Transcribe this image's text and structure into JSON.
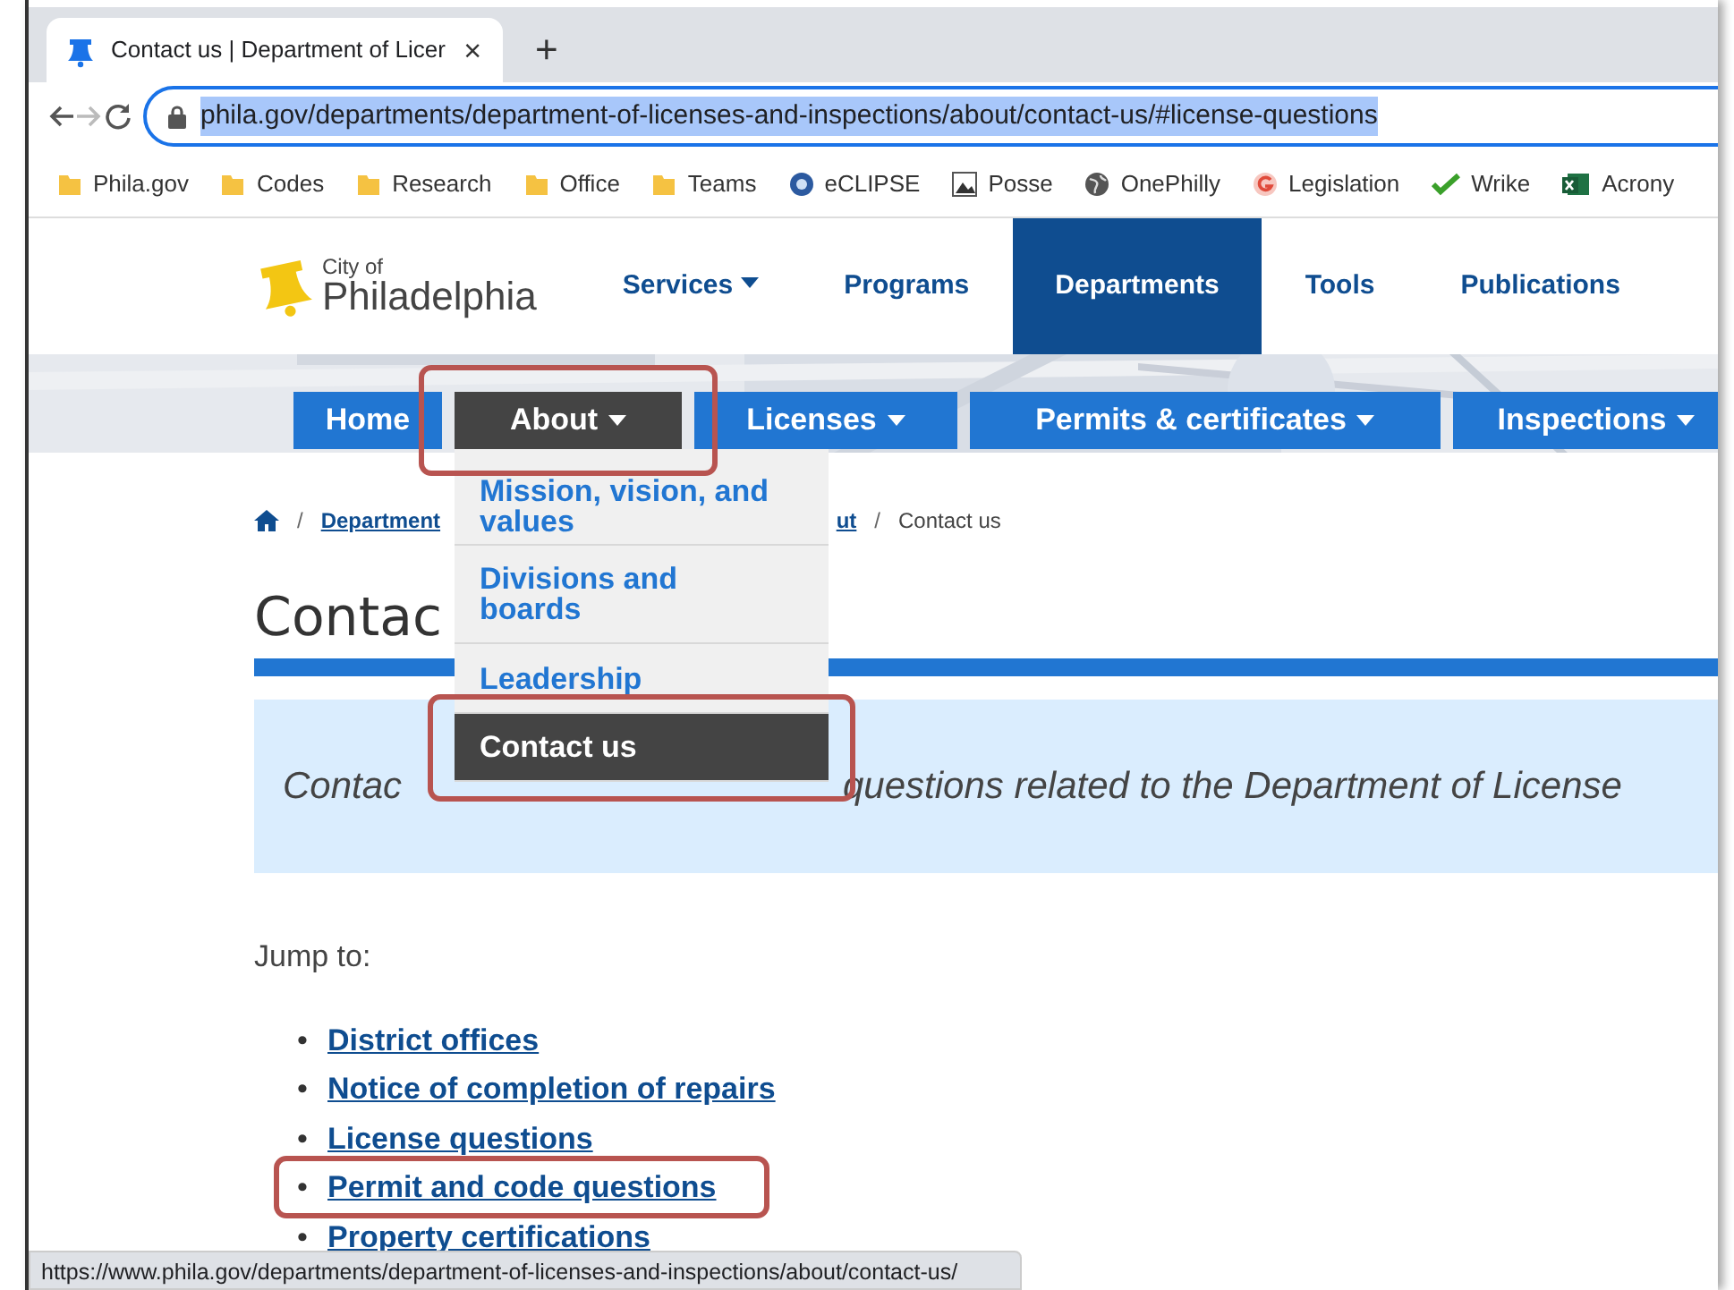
{
  "browser": {
    "tab": {
      "title": "Contact us | Department of Licer",
      "close": "×"
    },
    "new_tab": "+",
    "nav_buttons": [
      {
        "kind": "back",
        "disabled": false
      },
      {
        "kind": "forward",
        "disabled": true
      },
      {
        "kind": "reload",
        "disabled": false
      }
    ],
    "address": {
      "value": "phila.gov/departments/department-of-licenses-and-inspections/about/contact-us/#license-questions",
      "selected": true
    },
    "bookmarks": [
      {
        "label": "Phila.gov",
        "kind": "folder"
      },
      {
        "label": "Codes",
        "kind": "folder"
      },
      {
        "label": "Research",
        "kind": "folder"
      },
      {
        "label": "Office",
        "kind": "folder"
      },
      {
        "label": "Teams",
        "kind": "folder"
      },
      {
        "label": "eCLIPSE",
        "kind": "badge"
      },
      {
        "label": "Posse"
      },
      {
        "label": "OnePhilly",
        "kind": "globe"
      },
      {
        "label": "Legislation",
        "kind": "letter"
      },
      {
        "label": "Wrike",
        "kind": "check"
      },
      {
        "label": "Acrony",
        "kind": "sheet"
      }
    ],
    "status_url": "https://www.phila.gov/departments/department-of-licenses-and-inspections/about/contact-us/"
  },
  "site": {
    "logo": {
      "small": "City of",
      "name": "Philadelphia"
    },
    "main_nav": [
      {
        "label": "Services",
        "dropdown": true,
        "selected": false
      },
      {
        "label": "Programs",
        "dropdown": false,
        "selected": false
      },
      {
        "label": "Departments",
        "dropdown": false,
        "selected": true
      },
      {
        "label": "Tools",
        "dropdown": false,
        "selected": false
      },
      {
        "label": "Publications",
        "dropdown": false,
        "selected": false
      }
    ],
    "section_nav": [
      {
        "label": "Home",
        "dropdown": false,
        "open": false,
        "highlighted": false
      },
      {
        "label": "About",
        "dropdown": true,
        "open": true,
        "highlighted": true
      },
      {
        "label": "Licenses",
        "dropdown": true,
        "open": false,
        "highlighted": false
      },
      {
        "label": "Permits & certificates",
        "dropdown": true,
        "open": false,
        "highlighted": false
      },
      {
        "label": "Inspections",
        "dropdown": true,
        "open": false,
        "highlighted": false
      }
    ],
    "dropdown_menu": [
      {
        "label": "Mission, vision, and values",
        "selected": false,
        "highlighted": false
      },
      {
        "label": "Divisions and boards",
        "selected": false,
        "highlighted": false
      },
      {
        "label": "Leadership",
        "selected": false,
        "highlighted": false
      },
      {
        "label": "Contact us",
        "selected": true,
        "highlighted": true
      }
    ],
    "breadcrumb": [
      {
        "kind": "home"
      },
      {
        "kind": "link",
        "separator": "/",
        "label": "Department",
        "covered_after": true
      },
      {
        "kind": "link",
        "label": "ut",
        "covered_after": false
      },
      {
        "kind": "current",
        "separator": "/",
        "label": "Contact us"
      }
    ],
    "title": "Contac",
    "lede_parts": [
      "Contac",
      "questions related to the Department of License"
    ],
    "jump_label": "Jump to:",
    "jump_links": [
      {
        "bullet": "•",
        "label": "District offices",
        "highlighted": false
      },
      {
        "bullet": "•",
        "label": "Notice of completion of repairs",
        "highlighted": false
      },
      {
        "bullet": "•",
        "label": "License questions",
        "highlighted": false
      },
      {
        "bullet": "•",
        "label": "Permit and code questions",
        "highlighted": true
      },
      {
        "bullet": "•",
        "label": "Property certifications",
        "highlighted": false
      }
    ]
  }
}
